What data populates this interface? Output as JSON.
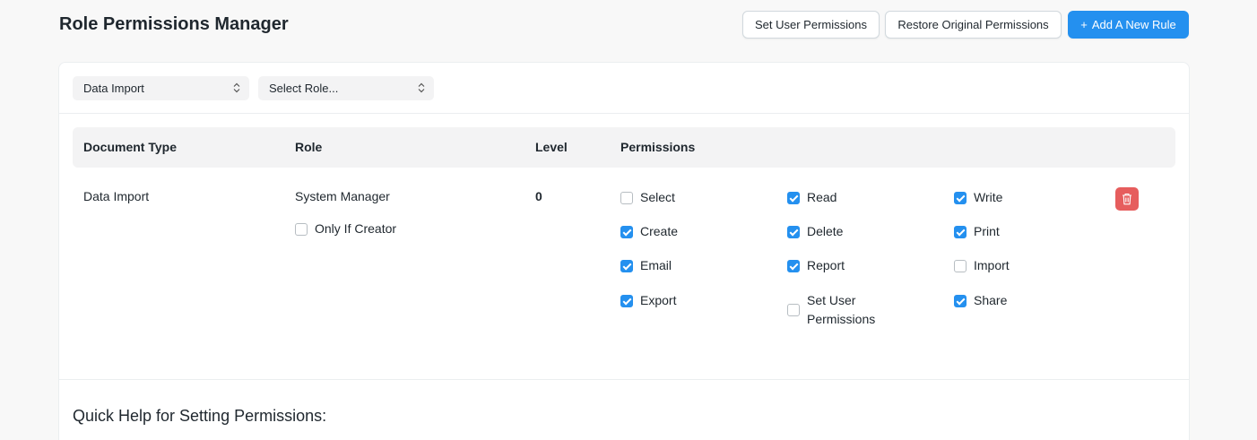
{
  "header": {
    "title": "Role Permissions Manager",
    "set_user_permissions": "Set User Permissions",
    "restore_original": "Restore Original Permissions",
    "add_rule": "Add A New Rule"
  },
  "filters": {
    "doctype": "Data Import",
    "role": "Select Role..."
  },
  "table": {
    "headers": {
      "document_type": "Document Type",
      "role": "Role",
      "level": "Level",
      "permissions": "Permissions"
    },
    "row": {
      "document_type": "Data Import",
      "role": "System Manager",
      "level": "0",
      "only_if_creator": {
        "label": "Only If Creator",
        "checked": false
      },
      "permissions": [
        {
          "label": "Select",
          "checked": false
        },
        {
          "label": "Read",
          "checked": true
        },
        {
          "label": "Write",
          "checked": true
        },
        {
          "label": "Create",
          "checked": true
        },
        {
          "label": "Delete",
          "checked": true
        },
        {
          "label": "Print",
          "checked": true
        },
        {
          "label": "Email",
          "checked": true
        },
        {
          "label": "Report",
          "checked": true
        },
        {
          "label": "Import",
          "checked": false
        },
        {
          "label": "Export",
          "checked": true
        },
        {
          "label": "Set User Permissions",
          "checked": false
        },
        {
          "label": "Share",
          "checked": true
        }
      ]
    }
  },
  "help": {
    "title": "Quick Help for Setting Permissions:"
  },
  "colors": {
    "primary": "#2490ef",
    "danger": "#e65d5d"
  }
}
